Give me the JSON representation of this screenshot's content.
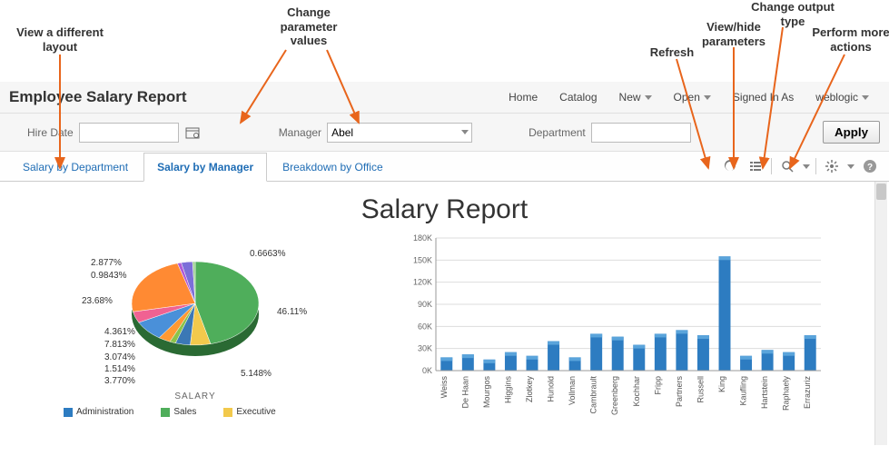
{
  "annotations": {
    "view_layout": "View a different\nlayout",
    "change_params": "Change\nparameter\nvalues",
    "refresh": "Refresh",
    "view_hide_params": "View/hide\nparameters",
    "change_output": "Change output\ntype",
    "more_actions": "Perform more\nactions"
  },
  "header": {
    "title": "Employee Salary Report",
    "nav": {
      "home": "Home",
      "catalog": "Catalog",
      "new": "New",
      "open": "Open",
      "signed_in_as": "Signed In As",
      "user": "weblogic"
    }
  },
  "params": {
    "hire_date_label": "Hire Date",
    "hire_date_value": "",
    "manager_label": "Manager",
    "manager_value": "Abel",
    "department_label": "Department",
    "department_value": "",
    "apply": "Apply"
  },
  "tabs": {
    "t0": "Salary by Department",
    "t1": "Salary by Manager",
    "t2": "Breakdown by Office"
  },
  "report": {
    "title": "Salary Report",
    "pie_subtitle": "SALARY",
    "legend": {
      "admin": "Administration",
      "sales": "Sales",
      "exec": "Executive"
    }
  },
  "chart_data": [
    {
      "type": "pie",
      "title": "SALARY",
      "slices": [
        {
          "label": "46.11%",
          "value": 46.11,
          "color": "#4fae5b"
        },
        {
          "label": "5.148%",
          "value": 5.148,
          "color": "#f2c94c"
        },
        {
          "label": "3.770%",
          "value": 3.77,
          "color": "#3b78b5"
        },
        {
          "label": "1.514%",
          "value": 1.514,
          "color": "#8bc34a"
        },
        {
          "label": "3.074%",
          "value": 3.074,
          "color": "#ff9933"
        },
        {
          "label": "7.813%",
          "value": 7.813,
          "color": "#4a90d9"
        },
        {
          "label": "4.361%",
          "value": 4.361,
          "color": "#f06292"
        },
        {
          "label": "23.68%",
          "value": 23.68,
          "color": "#ff8a33"
        },
        {
          "label": "0.9843%",
          "value": 0.9843,
          "color": "#b05bd6"
        },
        {
          "label": "2.877%",
          "value": 2.877,
          "color": "#7c6fd9"
        },
        {
          "label": "0.6663%",
          "value": 0.6663,
          "color": "#9bcf8f"
        }
      ]
    },
    {
      "type": "bar",
      "ylabel": "",
      "ylim": [
        0,
        180000
      ],
      "yticks": [
        "0K",
        "30K",
        "60K",
        "90K",
        "120K",
        "150K",
        "180K"
      ],
      "categories": [
        "Weiss",
        "De Haan",
        "Mourgos",
        "Higgins",
        "Zlotkey",
        "Hunold",
        "Vollman",
        "Cambrault",
        "Greenberg",
        "Kochhar",
        "Fripp",
        "Partners",
        "Russell",
        "King",
        "Kaufling",
        "Hartstein",
        "Raphaely",
        "Errazuriz"
      ],
      "values": [
        18000,
        22000,
        15000,
        25000,
        20000,
        40000,
        18000,
        50000,
        46000,
        35000,
        50000,
        55000,
        48000,
        155000,
        20000,
        28000,
        25000,
        48000
      ],
      "color": "#2d7cc1"
    }
  ]
}
